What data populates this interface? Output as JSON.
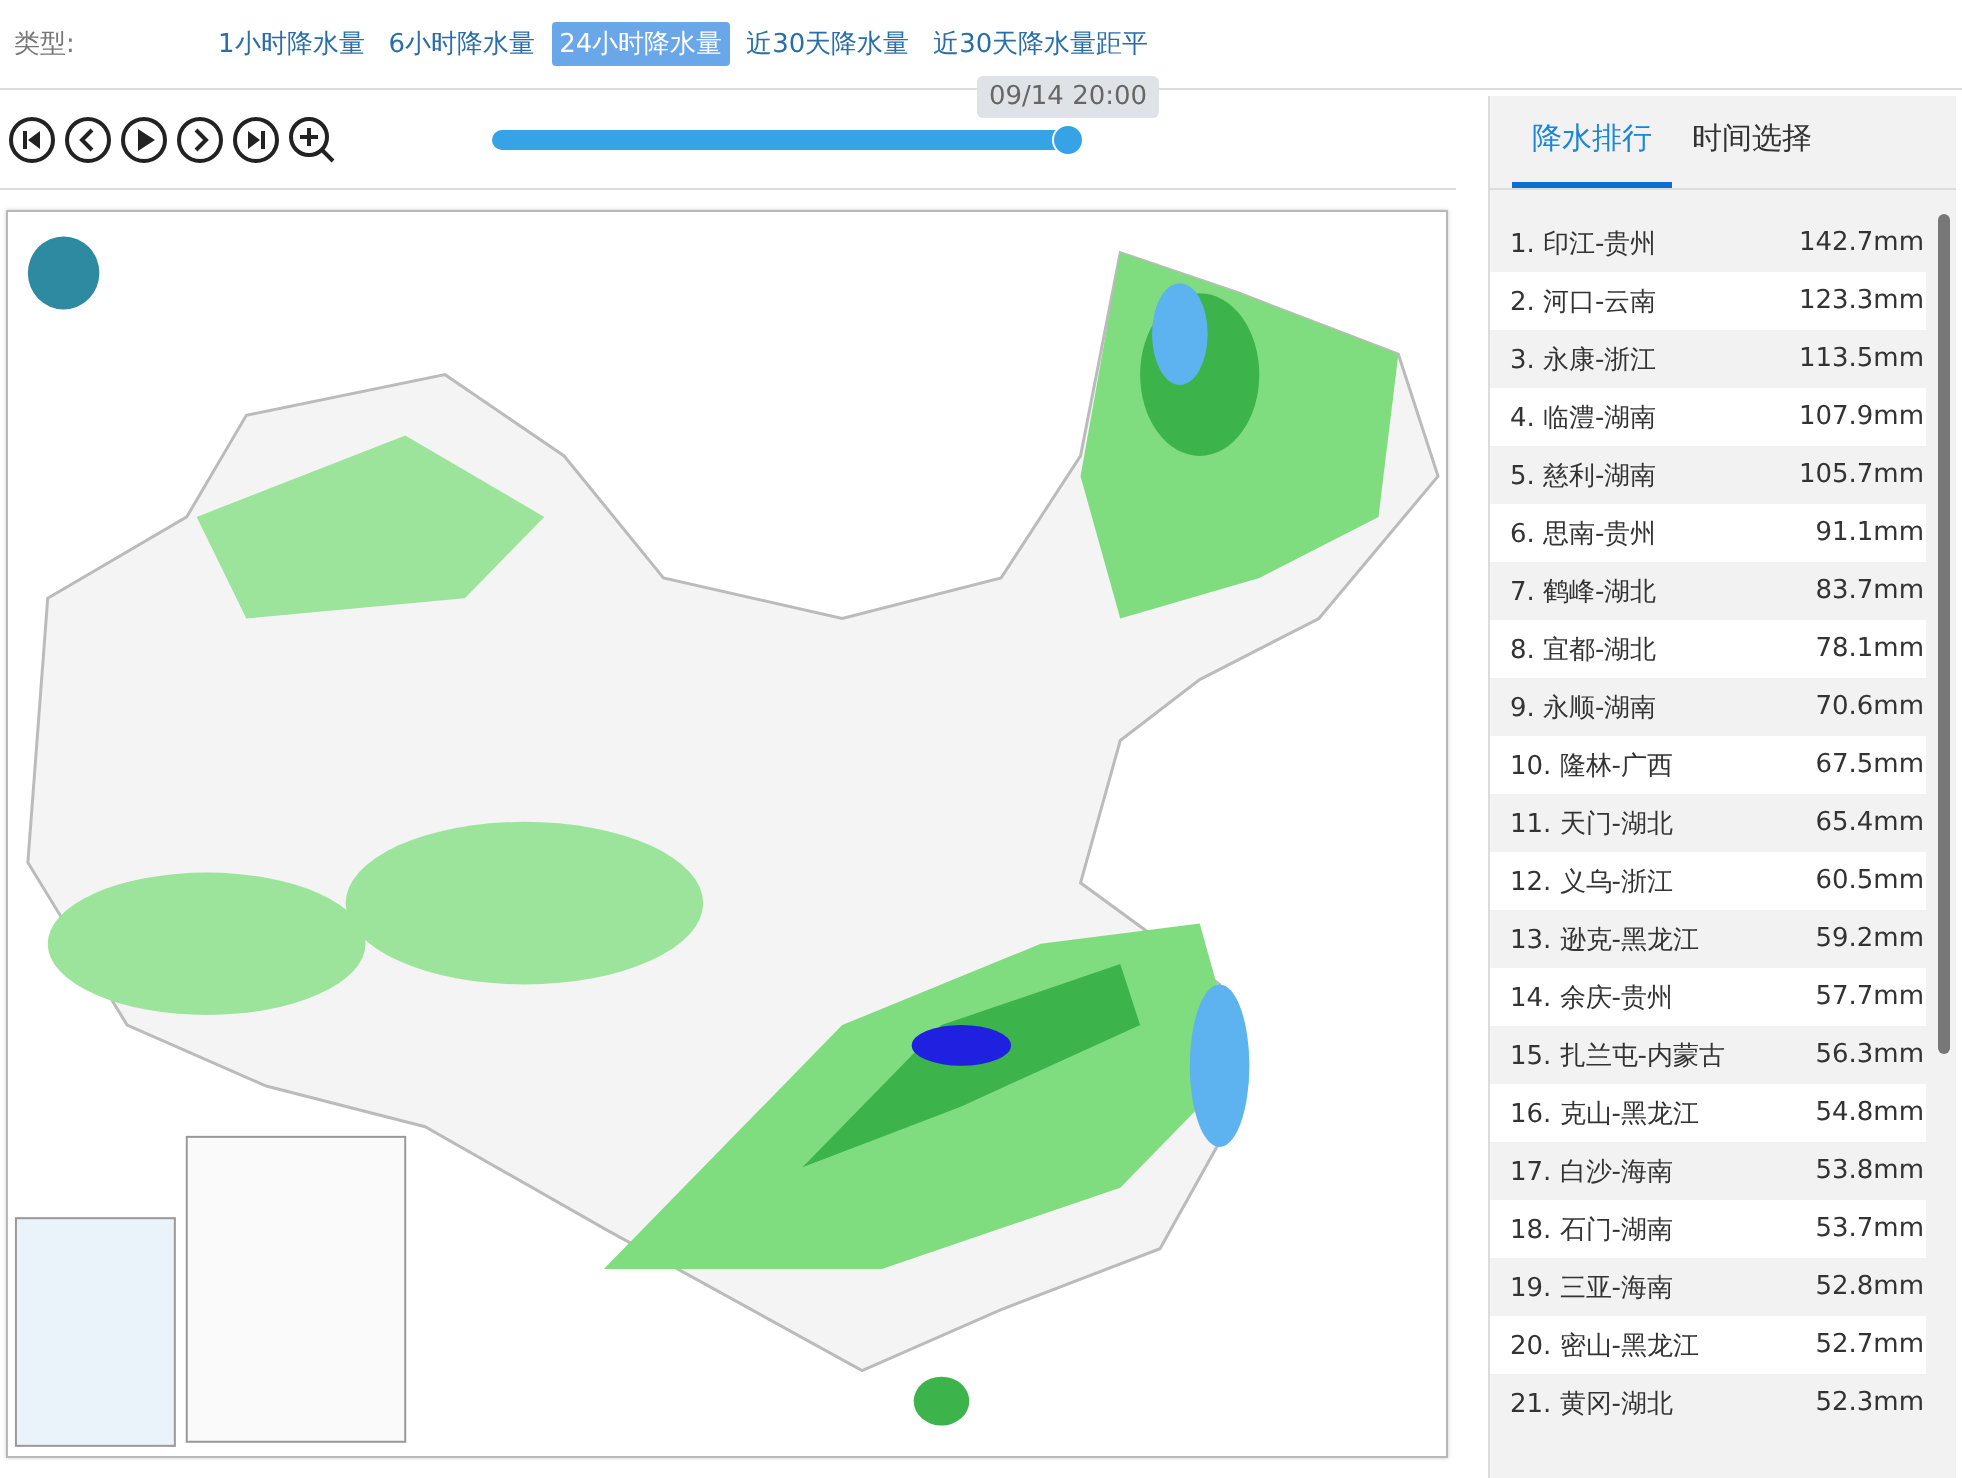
{
  "type_bar": {
    "label": "类型:",
    "options": [
      {
        "label": "1小时降水量",
        "selected": false
      },
      {
        "label": "6小时降水量",
        "selected": false
      },
      {
        "label": "24小时降水量",
        "selected": true
      },
      {
        "label": "近30天降水量",
        "selected": false
      },
      {
        "label": "近30天降水量距平",
        "selected": false
      }
    ]
  },
  "timeline": {
    "level": 1,
    "tooltip": "09/14 20:00"
  },
  "panel_tabs": [
    {
      "label": "降水排行",
      "selected": true
    },
    {
      "label": "时间选择",
      "selected": false
    }
  ],
  "ranking": [
    {
      "name": "1. 印江-贵州",
      "value": "142.7mm"
    },
    {
      "name": "2. 河口-云南",
      "value": "123.3mm"
    },
    {
      "name": "3. 永康-浙江",
      "value": "113.5mm"
    },
    {
      "name": "4. 临澧-湖南",
      "value": "107.9mm"
    },
    {
      "name": "5. 慈利-湖南",
      "value": "105.7mm"
    },
    {
      "name": "6. 思南-贵州",
      "value": "91.1mm"
    },
    {
      "name": "7. 鹤峰-湖北",
      "value": "83.7mm"
    },
    {
      "name": "8. 宜都-湖北",
      "value": "78.1mm"
    },
    {
      "name": "9. 永顺-湖南",
      "value": "70.6mm"
    },
    {
      "name": "10. 隆林-广西",
      "value": "67.5mm"
    },
    {
      "name": "11. 天门-湖北",
      "value": "65.4mm"
    },
    {
      "name": "12. 义乌-浙江",
      "value": "60.5mm"
    },
    {
      "name": "13. 逊克-黑龙江",
      "value": "59.2mm"
    },
    {
      "name": "14. 余庆-贵州",
      "value": "57.7mm"
    },
    {
      "name": "15. 扎兰屯-内蒙古",
      "value": "56.3mm"
    },
    {
      "name": "16. 克山-黑龙江",
      "value": "54.8mm"
    },
    {
      "name": "17. 白沙-海南",
      "value": "53.8mm"
    },
    {
      "name": "18. 石门-湖南",
      "value": "53.7mm"
    },
    {
      "name": "19. 三亚-海南",
      "value": "52.8mm"
    },
    {
      "name": "20. 密山-黑龙江",
      "value": "52.7mm"
    },
    {
      "name": "21. 黄冈-湖北",
      "value": "52.3mm"
    }
  ]
}
